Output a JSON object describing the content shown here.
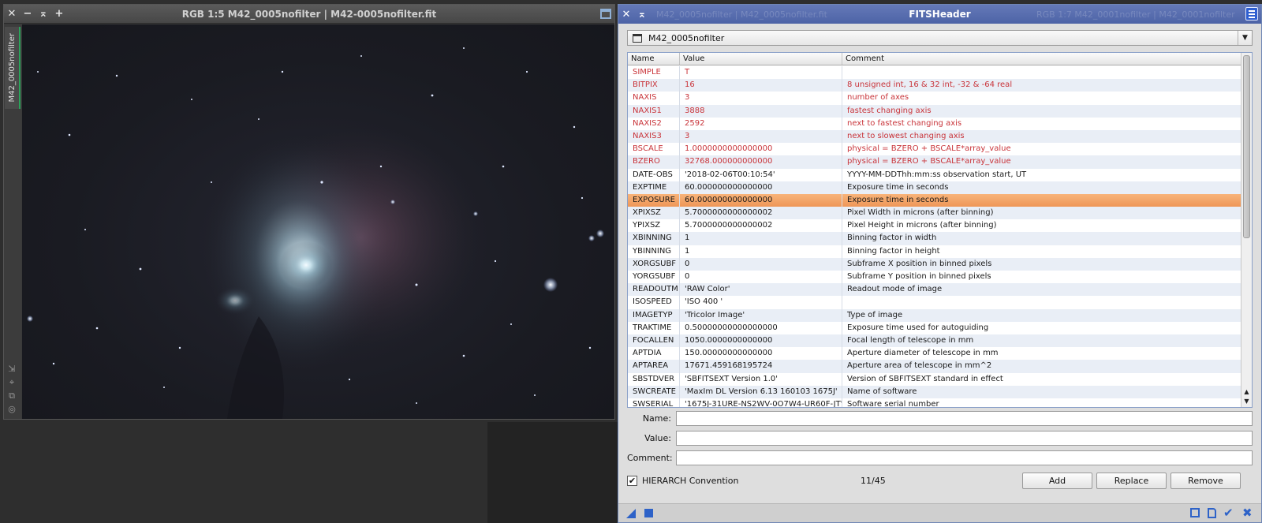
{
  "image_window": {
    "title": "RGB 1:5 M42_0005nofilter | M42-0005nofilter.fit",
    "controls": {
      "close": "✕",
      "minimize": "−",
      "shade": "⌅",
      "pin": "+"
    },
    "side_tab": "M42_0005nofilter",
    "side_icons": [
      "⇲",
      "⌖",
      "⧉",
      "◎"
    ]
  },
  "fits_window": {
    "title": "FITSHeader",
    "controls": {
      "close": "✕",
      "shade": "⌅"
    },
    "ghost_left": "M42_0005nofilter | M42_0005nofilter.fit",
    "ghost_right": "RGB 1:7 M42_0001nofilter | M42_0001nofilter",
    "view_selector": "M42_0005nofilter",
    "columns": [
      "Name",
      "Value",
      "Comment"
    ],
    "rows": [
      {
        "name": "SIMPLE",
        "value": "T",
        "comment": "",
        "reserved": true
      },
      {
        "name": "BITPIX",
        "value": "16",
        "comment": "8 unsigned int, 16 & 32 int, -32 & -64 real",
        "reserved": true
      },
      {
        "name": "NAXIS",
        "value": "3",
        "comment": "number of axes",
        "reserved": true
      },
      {
        "name": "NAXIS1",
        "value": "3888",
        "comment": "fastest changing axis",
        "reserved": true
      },
      {
        "name": "NAXIS2",
        "value": "2592",
        "comment": "next to fastest changing axis",
        "reserved": true
      },
      {
        "name": "NAXIS3",
        "value": "3",
        "comment": "next to slowest changing axis",
        "reserved": true
      },
      {
        "name": "BSCALE",
        "value": "1.0000000000000000",
        "comment": "physical = BZERO + BSCALE*array_value",
        "reserved": true
      },
      {
        "name": "BZERO",
        "value": "32768.000000000000",
        "comment": "physical = BZERO + BSCALE*array_value",
        "reserved": true
      },
      {
        "name": "DATE-OBS",
        "value": "'2018-02-06T00:10:54'",
        "comment": "YYYY-MM-DDThh:mm:ss observation start, UT",
        "reserved": false
      },
      {
        "name": "EXPTIME",
        "value": "60.000000000000000",
        "comment": "Exposure time in seconds",
        "reserved": false
      },
      {
        "name": "EXPOSURE",
        "value": "60.000000000000000",
        "comment": "Exposure time in seconds",
        "reserved": false,
        "selected": true
      },
      {
        "name": "XPIXSZ",
        "value": "5.7000000000000002",
        "comment": "Pixel Width in microns (after binning)",
        "reserved": false
      },
      {
        "name": "YPIXSZ",
        "value": "5.7000000000000002",
        "comment": "Pixel Height in microns (after binning)",
        "reserved": false
      },
      {
        "name": "XBINNING",
        "value": "1",
        "comment": "Binning factor in width",
        "reserved": false
      },
      {
        "name": "YBINNING",
        "value": "1",
        "comment": "Binning factor in height",
        "reserved": false
      },
      {
        "name": "XORGSUBF",
        "value": "0",
        "comment": "Subframe X position in binned pixels",
        "reserved": false
      },
      {
        "name": "YORGSUBF",
        "value": "0",
        "comment": "Subframe Y position in binned pixels",
        "reserved": false
      },
      {
        "name": "READOUTM",
        "value": "'RAW Color'",
        "comment": "Readout mode of image",
        "reserved": false
      },
      {
        "name": "ISOSPEED",
        "value": "'ISO 400 '",
        "comment": "",
        "reserved": false
      },
      {
        "name": "IMAGETYP",
        "value": "'Tricolor Image'",
        "comment": "Type of image",
        "reserved": false
      },
      {
        "name": "TRAKTIME",
        "value": "0.50000000000000000",
        "comment": "Exposure time used for autoguiding",
        "reserved": false
      },
      {
        "name": "FOCALLEN",
        "value": "1050.0000000000000",
        "comment": "Focal length of telescope in mm",
        "reserved": false
      },
      {
        "name": "APTDIA",
        "value": "150.00000000000000",
        "comment": "Aperture diameter of telescope in mm",
        "reserved": false
      },
      {
        "name": "APTAREA",
        "value": "17671.459168195724",
        "comment": "Aperture area of telescope in mm^2",
        "reserved": false
      },
      {
        "name": "SBSTDVER",
        "value": "'SBFITSEXT Version 1.0'",
        "comment": "Version of SBFITSEXT standard in effect",
        "reserved": false
      },
      {
        "name": "SWCREATE",
        "value": "'MaxIm DL Version 6.13 160103 1675J'",
        "comment": "Name of software",
        "reserved": false
      },
      {
        "name": "SWSERIAL",
        "value": "'1675J-31URE-NS2WV-0O7W4-UR60F-JT'",
        "comment": "Software serial number",
        "reserved": false
      }
    ],
    "form": {
      "name_label": "Name:",
      "value_label": "Value:",
      "comment_label": "Comment:",
      "name_value": "",
      "value_value": "",
      "comment_value": ""
    },
    "hierarch": {
      "checked": true,
      "mark": "✔",
      "label": "HIERARCH Convention"
    },
    "count": "11/45",
    "buttons": {
      "add": "Add",
      "replace": "Replace",
      "remove": "Remove"
    },
    "footer_icons": {
      "check": "✔",
      "cross": "✖"
    }
  },
  "colors": {
    "accent": "#2d62c8",
    "reserved_keyword": "#c9343a",
    "selection": "#f0a066",
    "title_bar": "#5a6fb0"
  }
}
